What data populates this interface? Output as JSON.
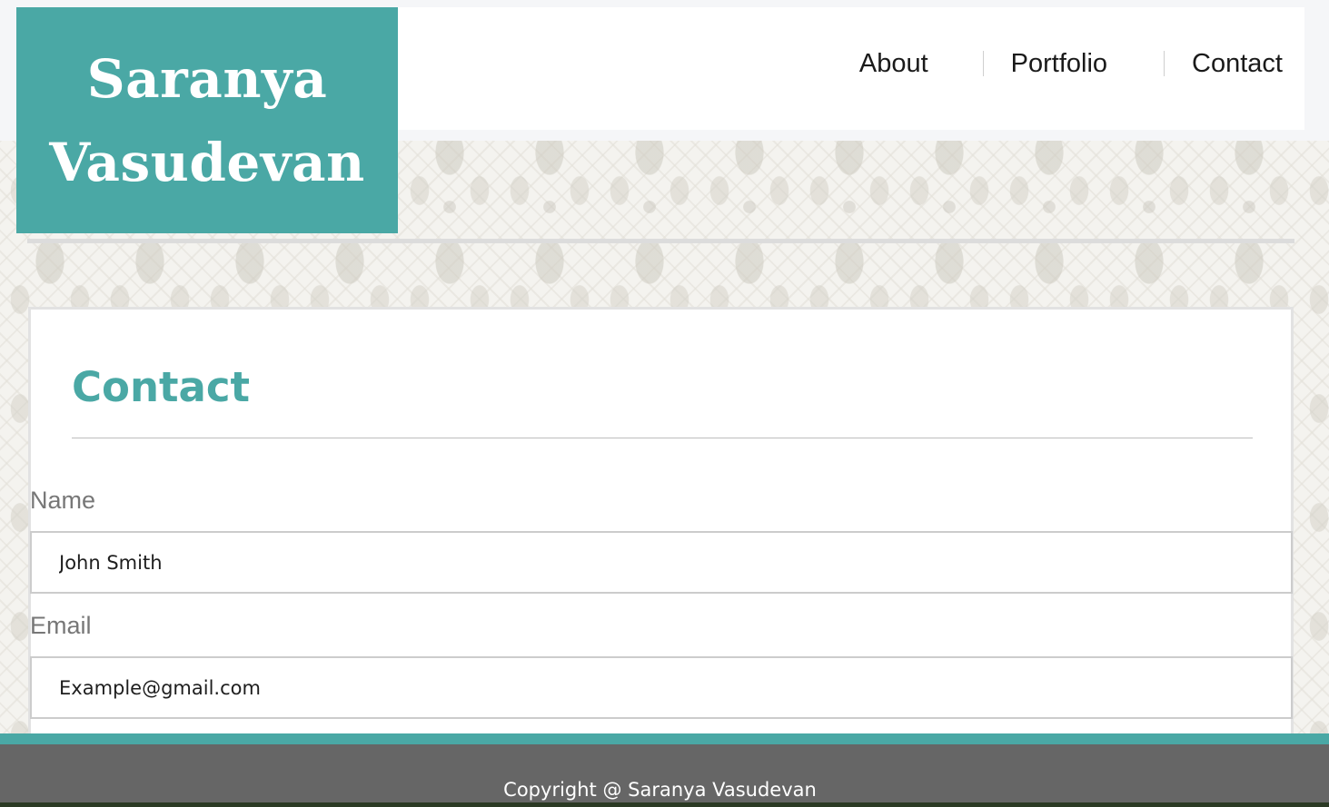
{
  "brand": {
    "line1": "Saranya",
    "line2": "Vasudevan",
    "color": "#4aa8a5"
  },
  "nav": {
    "items": [
      {
        "label": "About"
      },
      {
        "label": "Portfolio"
      },
      {
        "label": "Contact"
      }
    ]
  },
  "main": {
    "title": "Contact",
    "form": {
      "name_label": "Name",
      "name_value": "John Smith",
      "email_label": "Email",
      "email_value": "Example@gmail.com"
    }
  },
  "footer": {
    "text": "Copyright @ Saranya Vasudevan",
    "background": "#666666",
    "accent": "#4aa8a5"
  }
}
